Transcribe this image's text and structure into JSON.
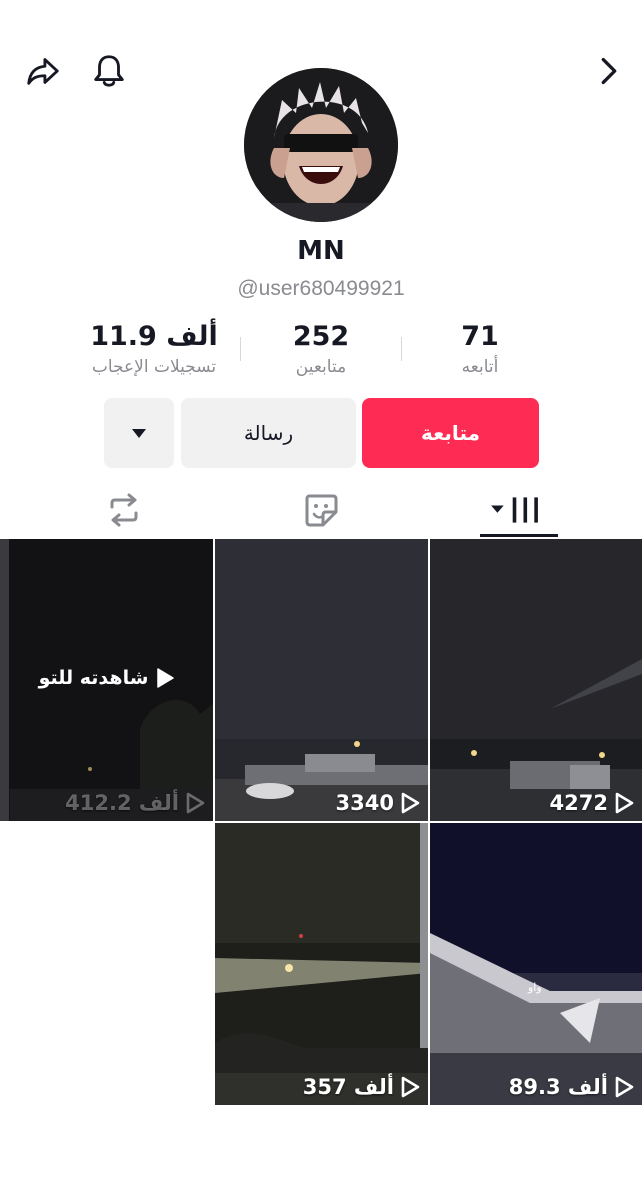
{
  "profile": {
    "name": "MN",
    "handle": "@user680499921"
  },
  "stats": {
    "likes": {
      "value": "11.9 ألف",
      "label": "تسجيلات الإعجاب"
    },
    "followers": {
      "value": "252",
      "label": "متابعين"
    },
    "following": {
      "value": "71",
      "label": "أتابعه"
    }
  },
  "actions": {
    "follow_label": "متابعة",
    "message_label": "رسالة"
  },
  "header_icons": [
    "share-icon",
    "bell-icon",
    "chevron-right-icon"
  ],
  "tabs": [
    "videos-grid-icon",
    "favorites-sticker-icon",
    "reposts-icon"
  ],
  "videos": [
    {
      "views": "4272"
    },
    {
      "views": "3340"
    },
    {
      "views": "412.2 ألف",
      "badge": "شاهدته للتو"
    },
    {
      "views": "89.3 ألف",
      "caption": "واو"
    },
    {
      "views": "357 ألف"
    }
  ],
  "colors": {
    "follow_button": "#fe2c55",
    "secondary_button": "#f1f1f2",
    "muted_text": "#8a8b91"
  }
}
